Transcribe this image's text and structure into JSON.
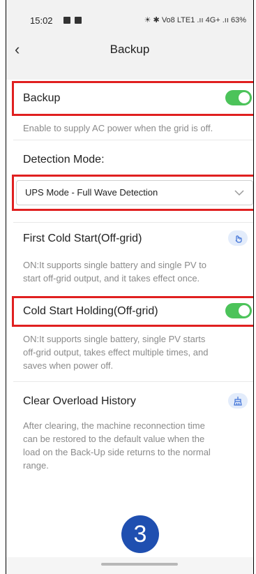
{
  "status_bar": {
    "time": "15:02",
    "right_text": "☀ ✱ Vo8 LTE1 .ıı 4G+ .ıı 63%"
  },
  "header": {
    "back_label": "‹",
    "title": "Backup"
  },
  "backup": {
    "label": "Backup",
    "enabled": true,
    "description": "Enable to supply AC power when the grid is off."
  },
  "detection": {
    "label": "Detection Mode:",
    "selected": "UPS Mode - Full Wave Detection"
  },
  "first_cold_start": {
    "label": "First Cold Start(Off-grid)",
    "description_line1": "ON:It supports single battery and single PV to",
    "description_line2": "start off-grid output, and it takes effect once."
  },
  "cold_start_holding": {
    "label": "Cold Start Holding(Off-grid)",
    "enabled": true,
    "description_line1": "ON:It supports single battery, single PV starts",
    "description_line2": "off-grid output, takes effect multiple times, and",
    "description_line3": "saves when power off."
  },
  "clear_overload": {
    "label": "Clear Overload History",
    "description_line1": "After clearing, the machine reconnection time",
    "description_line2": "can be restored to the default value when the",
    "description_line3": "load on the Back-Up side returns to the normal",
    "description_line4": "range."
  },
  "step_badge": "3",
  "colors": {
    "toggle_on": "#4cc35a",
    "highlight": "#e02020",
    "badge": "#1f4fb0"
  }
}
